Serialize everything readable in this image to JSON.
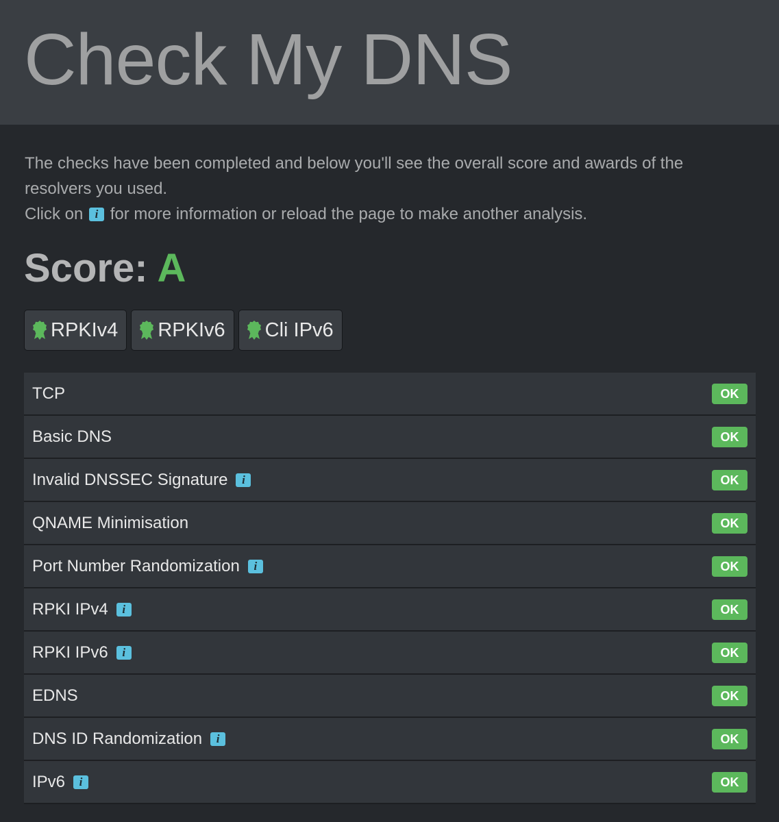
{
  "header": {
    "title": "Check My DNS"
  },
  "intro": {
    "line1": "The checks have been completed and below you'll see the overall score and awards of the resolvers you used.",
    "line2_before": "Click on",
    "line2_after": "for more information or reload the page to make another analysis."
  },
  "score": {
    "label": "Score:",
    "grade": "A"
  },
  "awards": [
    {
      "label": "RPKIv4",
      "icon": "award-icon"
    },
    {
      "label": "RPKIv6",
      "icon": "award-icon"
    },
    {
      "label": "Cli IPv6",
      "icon": "award-icon"
    }
  ],
  "checks": [
    {
      "name": "TCP",
      "status": "OK",
      "info": false
    },
    {
      "name": "Basic DNS",
      "status": "OK",
      "info": false
    },
    {
      "name": "Invalid DNSSEC Signature",
      "status": "OK",
      "info": true
    },
    {
      "name": "QNAME Minimisation",
      "status": "OK",
      "info": false
    },
    {
      "name": "Port Number Randomization",
      "status": "OK",
      "info": true
    },
    {
      "name": "RPKI IPv4",
      "status": "OK",
      "info": true
    },
    {
      "name": "RPKI IPv6",
      "status": "OK",
      "info": true
    },
    {
      "name": "EDNS",
      "status": "OK",
      "info": false
    },
    {
      "name": "DNS ID Randomization",
      "status": "OK",
      "info": true
    },
    {
      "name": "IPv6",
      "status": "OK",
      "info": true
    }
  ],
  "colors": {
    "success": "#5cb85c",
    "info": "#5bc0de",
    "header_bg": "#3a3e43",
    "page_bg": "#25282c"
  }
}
